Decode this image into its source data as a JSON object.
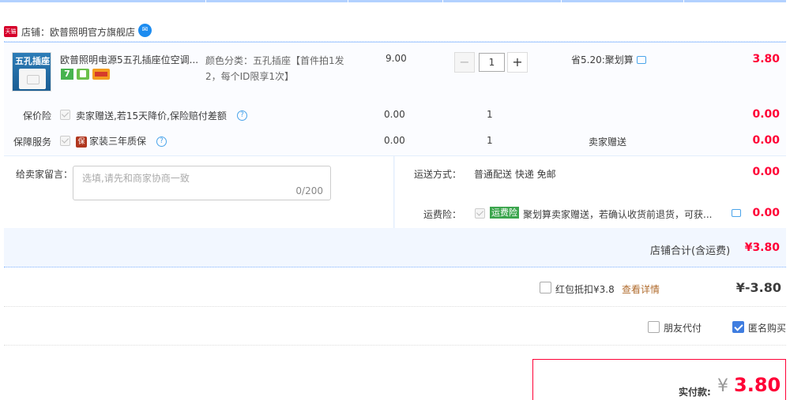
{
  "store": {
    "badge": "天猫",
    "label": "店铺：欧普照明官方旗舰店",
    "chat_icon": "wangwang-icon"
  },
  "item": {
    "thumb_text": "五孔插座",
    "title": "欧普照明电源5五孔插座位空调...",
    "sku_line1": "颜色分类：五孔插座【首件拍1发",
    "sku_line2": "2，每个ID限享1次】",
    "unit_price": "9.00",
    "quantity": "1",
    "minus": "−",
    "plus": "+",
    "promo": "省5.20:聚划算",
    "subtotal": "3.80",
    "badge_7": "7"
  },
  "services": [
    {
      "label": "保价险",
      "text": "卖家赠送,若15天降价,保险赔付差额",
      "price": "0.00",
      "qty": "1",
      "note": "",
      "total": "0.00"
    },
    {
      "label": "保障服务",
      "badge": "保",
      "text": "家装三年质保",
      "price": "0.00",
      "qty": "1",
      "note": "卖家赠送",
      "total": "0.00"
    }
  ],
  "message": {
    "label": "给卖家留言：",
    "placeholder": "选填,请先和商家协商一致",
    "counter": "0/200"
  },
  "shipping": {
    "label": "运送方式：",
    "value": "普通配送 快递 免邮",
    "total": "0.00"
  },
  "shipping_insurance": {
    "label": "运费险：",
    "badge": "运费险",
    "text": "聚划算卖家赠送，若确认收货前退货，可获...",
    "total": "0.00"
  },
  "store_total": {
    "label": "店铺合计(含运费)",
    "value": "¥3.80"
  },
  "redpack": {
    "text": "红包抵扣¥3.8",
    "link": "查看详情",
    "value": "¥-3.80",
    "checked": false
  },
  "options": {
    "friend_pay": "朋友代付",
    "anonymous": "匿名购买",
    "friend_pay_checked": false,
    "anonymous_checked": true
  },
  "payment": {
    "label": "实付款:",
    "currency": "¥",
    "value": "3.80"
  }
}
